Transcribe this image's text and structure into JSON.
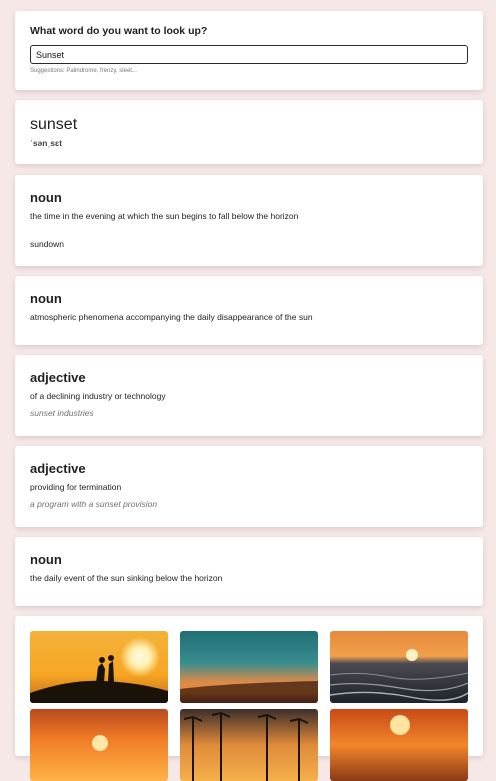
{
  "search": {
    "title": "What word do you want to look up?",
    "value": "Sunset",
    "suggestions": "Suggestions: Palindrome, frenzy, sleet..."
  },
  "entry": {
    "word": "sunset",
    "phonetic": "ˈsənˌsɛt"
  },
  "definitions": [
    {
      "pos": "noun",
      "definition": "the time in the evening at which the sun begins to fall below the horizon",
      "synonym": "sundown"
    },
    {
      "pos": "noun",
      "definition": "atmospheric phenomena accompanying the daily disappearance of the sun"
    },
    {
      "pos": "adjective",
      "definition": "of a declining industry or technology",
      "example": "sunset industries"
    },
    {
      "pos": "adjective",
      "definition": "providing for termination",
      "example": "a program with a sunset provision"
    },
    {
      "pos": "noun",
      "definition": "the daily event of the sun sinking below the horizon"
    }
  ],
  "images": [
    "silhouette-couple-sunset-image",
    "teal-sky-sunset-image",
    "ocean-waves-sunset-image",
    "orange-horizon-sunset-image",
    "palm-trees-sunset-image",
    "sea-sun-sunset-image"
  ],
  "colors": {
    "background": "#f6e8e7",
    "card": "#ffffff"
  }
}
